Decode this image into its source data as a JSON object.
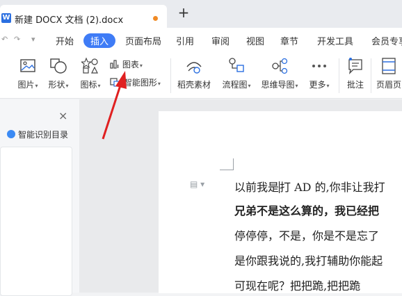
{
  "tabbar": {
    "doc_icon": "W",
    "doc_title": "新建 DOCX 文档 (2).docx",
    "new_tab": "+",
    "modified_dot_color": "#f08a24"
  },
  "menubar": {
    "undo_glyph": "↶",
    "redo_glyph": "↷",
    "more_glyph": "▾",
    "items": [
      "开始",
      "插入",
      "页面布局",
      "引用",
      "审阅",
      "视图",
      "章节",
      "开发工具",
      "会员专享"
    ],
    "active_index": 1,
    "accent_color": "#3f7cf6"
  },
  "toolbar": {
    "picture": "图片",
    "shape": "形状",
    "icon": "图标",
    "chart": "图表",
    "smart_shape": "智能图形",
    "dao_material": "稻壳素材",
    "flowchart": "流程图",
    "mindmap": "思维导图",
    "more": "更多",
    "comment": "批注",
    "header_footer": "页眉页"
  },
  "left_panel": {
    "close": "×",
    "smart_toc": "智能识别目录"
  },
  "document": {
    "line1_a": "以前我是",
    "line1_b": "打 AD 的,你非让我打",
    "line2": "兄弟不是这么算的，我已经把",
    "line3": "停停停，不是，你是不是忘了",
    "line4": "是你跟我说的,我打辅助你能起",
    "line5": "可现在呢？把把跪,把把跪"
  },
  "annotation": {
    "arrow_color": "#e02020"
  }
}
